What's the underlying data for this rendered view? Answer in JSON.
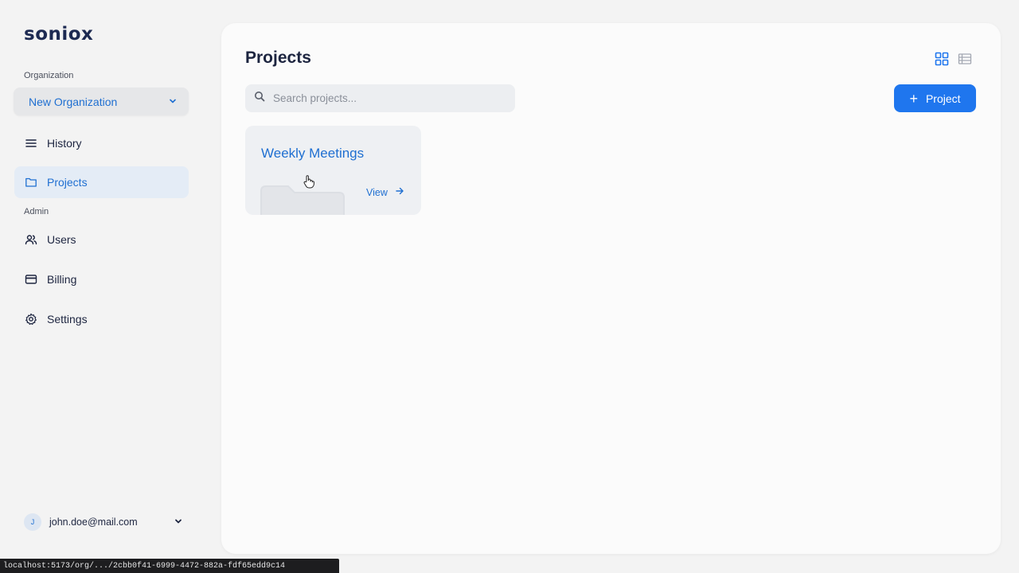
{
  "brand": {
    "logo_text": "soniox"
  },
  "sidebar": {
    "organization_label": "Organization",
    "organization_value": "New Organization",
    "items": [
      {
        "label": "History",
        "icon": "list-icon",
        "active": false
      },
      {
        "label": "Projects",
        "icon": "folder-icon",
        "active": true
      }
    ],
    "admin_label": "Admin",
    "admin_items": [
      {
        "label": "Users",
        "icon": "users-icon"
      },
      {
        "label": "Billing",
        "icon": "credit-card-icon"
      },
      {
        "label": "Settings",
        "icon": "gear-icon"
      }
    ],
    "user": {
      "avatar_initial": "J",
      "email": "john.doe@mail.com"
    }
  },
  "main": {
    "title": "Projects",
    "search": {
      "placeholder": "Search projects...",
      "value": ""
    },
    "add_button_label": "Project",
    "projects": [
      {
        "name": "Weekly Meetings",
        "action_label": "View"
      }
    ]
  },
  "statusbar": {
    "url": "localhost:5173/org/.../2cbb0f41-6999-4472-882a-fdf65edd9c14"
  },
  "colors": {
    "accent": "#1f76ee",
    "link": "#1f6fd1",
    "active_nav_bg": "#e4ecf6",
    "text": "#1d2540"
  }
}
